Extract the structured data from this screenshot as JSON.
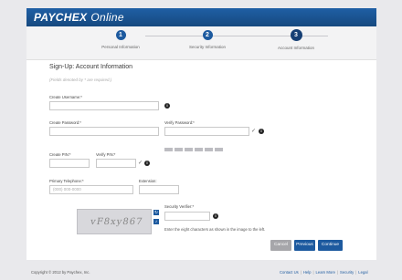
{
  "header": {
    "brand": "PAYCHEX",
    "product": "Online"
  },
  "steps": [
    {
      "number": "1",
      "label": "Personal Information"
    },
    {
      "number": "2",
      "label": "Security Information"
    },
    {
      "number": "3",
      "label": "Account Information"
    }
  ],
  "form": {
    "title": "Sign-Up: Account Information",
    "required_note": "(Fields denoted by * are required.)",
    "username_label": "Create Username:*",
    "password_label": "Create Password:*",
    "verify_password_label": "Verify Password:*",
    "pin_label": "Create PIN:*",
    "verify_pin_label": "Verify PIN:*",
    "phone_label": "Primary Telephone:*",
    "phone_placeholder": "(000) 000-0000",
    "extension_label": "Extension:",
    "security_label": "Security Verifier:*",
    "captcha_text": "vF8xy867",
    "captcha_instruction": "Enter the eight characters as shown in the image to the left."
  },
  "buttons": {
    "cancel": "Cancel",
    "previous": "Previous",
    "continue": "Continue"
  },
  "footer": {
    "copyright": "Copyright © 2012 by Paychex, Inc.",
    "links": [
      "Contact Us",
      "Help",
      "Learn More",
      "Security",
      "Legal"
    ]
  },
  "colors": {
    "brand": "#1d5a9f",
    "header": "#1f5fa5",
    "cancel": "#a6a6aa"
  }
}
